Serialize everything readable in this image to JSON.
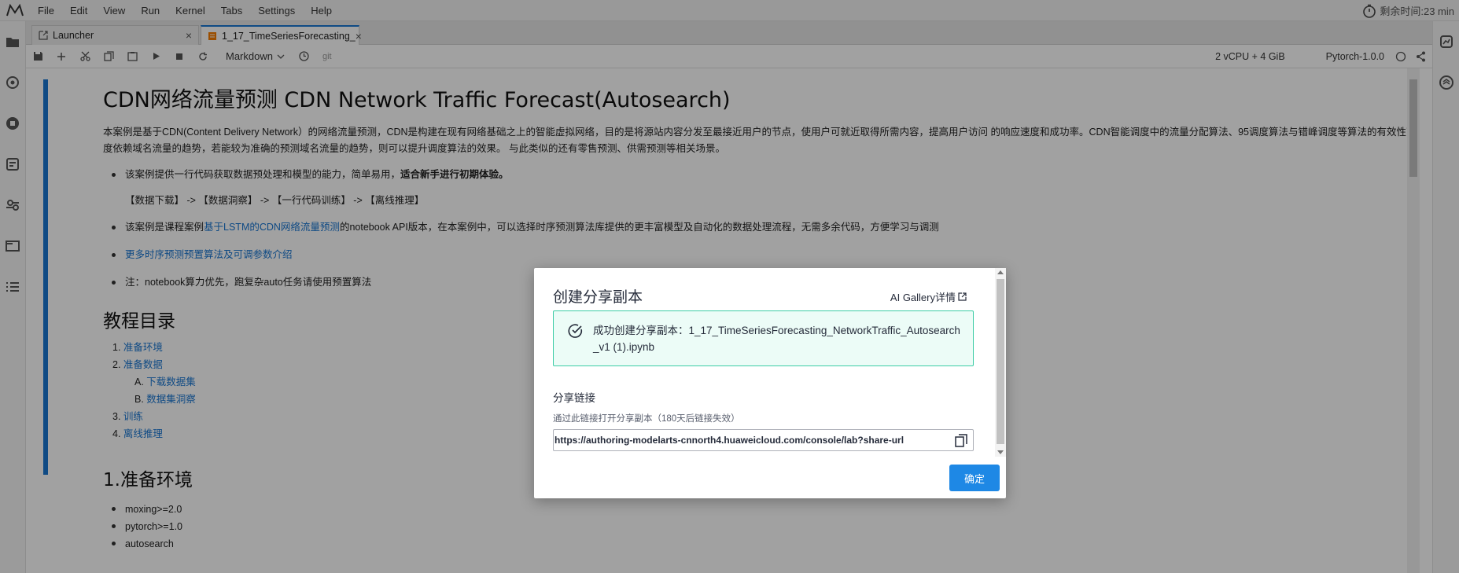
{
  "menubar": {
    "items": [
      "File",
      "Edit",
      "View",
      "Run",
      "Kernel",
      "Tabs",
      "Settings",
      "Help"
    ],
    "timer_text": "剩余时间:23 min"
  },
  "tabs": [
    {
      "label": "Launcher",
      "close": "×"
    },
    {
      "label": "1_17_TimeSeriesForecasting_",
      "close": "×"
    }
  ],
  "toolbar": {
    "cell_type": "Markdown",
    "git_label": "git",
    "resources": "2 vCPU + 4 GiB",
    "kernel": "Pytorch-1.0.0"
  },
  "notebook": {
    "title": "CDN网络流量预测 CDN Network Traffic Forecast(Autosearch)",
    "intro": "本案例是基于CDN(Content Delivery Network）的网络流量预测，CDN是构建在现有网络基础之上的智能虚拟网络，目的是将源站内容分发至最接近用户的节点，使用户可就近取得所需内容，提高用户访问 的响应速度和成功率。CDN智能调度中的流量分配算法、95调度算法与错峰调度等算法的有效性高度依赖域名流量的趋势，若能较为准确的预测域名流量的趋势，则可以提升调度算法的效果。 与此类似的还有零售预测、供需预测等相关场景。",
    "bullet1_prefix": "该案例提供一行代码获取数据预处理和模型的能力，简单易用，",
    "bullet1_bold": "适合新手进行初期体验。",
    "steps": "【数据下载】 -> 【数据洞察】 -> 【一行代码训练】 -> 【离线推理】",
    "bullet2_prefix": "该案例是课程案例",
    "bullet2_link": "基于LSTM的CDN网络流量预测",
    "bullet2_suffix": "的notebook API版本，在本案例中，可以选择时序预测算法库提供的更丰富模型及自动化的数据处理流程，无需多余代码，方便学习与调测",
    "bullet3_link": "更多时序预测预置算法及可调参数介绍",
    "bullet4": "注：notebook算力优先，跑复杂auto任务请使用预置算法",
    "toc_title": "教程目录",
    "toc": [
      {
        "num": "1.",
        "label": "准备环境",
        "level": 1
      },
      {
        "num": "2.",
        "label": "准备数据",
        "level": 1
      },
      {
        "num": "A.",
        "label": "下载数据集",
        "level": 2
      },
      {
        "num": "B.",
        "label": "数据集洞察",
        "level": 2
      },
      {
        "num": "3.",
        "label": "训练",
        "level": 1
      },
      {
        "num": "4.",
        "label": "离线推理",
        "level": 1
      }
    ],
    "section1_title": "1.准备环境",
    "env": [
      "moxing>=2.0",
      "pytorch>=1.0",
      "autosearch"
    ]
  },
  "modal": {
    "title": "创建分享副本",
    "gallery_link": "AI Gallery详情",
    "success_msg": "成功创建分享副本：1_17_TimeSeriesForecasting_NetworkTraffic_Autosearch_v1 (1).ipynb",
    "share_label": "分享链接",
    "share_hint": "通过此链接打开分享副本（180天后链接失效）",
    "share_url": "https://authoring-modelarts-cnnorth4.huaweicloud.com/console/lab?share-url",
    "ok_button": "确定"
  }
}
